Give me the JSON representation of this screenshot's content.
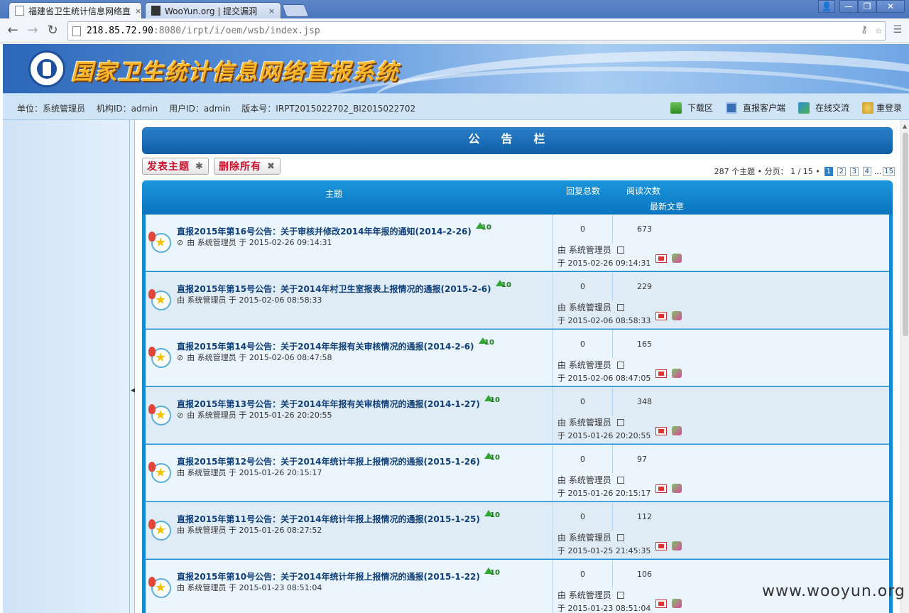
{
  "browser": {
    "tabs": [
      {
        "label": "福建省卫生统计信息网络直",
        "close": "×"
      },
      {
        "label": "WooYun.org | 提交漏洞",
        "close": "×"
      }
    ],
    "url_host": "218.85.72.90",
    "url_rest": ":8080/irpt/i/oem/wsb/index.jsp",
    "window_buttons": [
      "👤",
      "—",
      "❐",
      "✕"
    ]
  },
  "header": {
    "system_title": "国家卫生统计信息网络直报系统"
  },
  "infobar": {
    "unit": "单位：系统管理员",
    "org_id": "机构ID：admin",
    "user_id": "用户ID：admin",
    "version": "版本号：IRPT2015022702_BI2015022702",
    "links": [
      "下载区",
      "直报客户端",
      "在线交流",
      "重登录"
    ]
  },
  "bulletin": {
    "title": "公告栏",
    "post_button": "发表主题",
    "delete_button": "删除所有",
    "pager": {
      "summary": "287 个主题 • 分页： 1 / 15 •",
      "pages": [
        "1",
        "2",
        "3",
        "4"
      ],
      "ellipsis": "...",
      "last": "15"
    },
    "columns": {
      "topic": "主题",
      "replies": "回复总数",
      "views": "阅读次数",
      "latest": "最新文章"
    },
    "rows": [
      {
        "title": "直报2015年第16号公告：关于审核并修改2014年年报的通知(2014-2-26)",
        "attach": true,
        "meta": "由 系统管理员 于 2015-02-26 09:14:31",
        "replies": "0",
        "views": "673",
        "latest_by": "由 系统管理员",
        "latest_at": "于 2015-02-26 09:14:31"
      },
      {
        "title": "直报2015年第15号公告：关于2014年村卫生室报表上报情况的通报(2015-2-6)",
        "attach": false,
        "meta": "由 系统管理员 于 2015-02-06 08:58:33",
        "replies": "0",
        "views": "229",
        "latest_by": "由 系统管理员",
        "latest_at": "于 2015-02-06 08:58:33"
      },
      {
        "title": "直报2015年第14号公告：关于2014年年报有关审核情况的通报(2014-2-6)",
        "attach": true,
        "meta": "由 系统管理员 于 2015-02-06 08:47:58",
        "replies": "0",
        "views": "165",
        "latest_by": "由 系统管理员",
        "latest_at": "于 2015-02-06 08:47:05"
      },
      {
        "title": "直报2015年第13号公告：关于2014年年报有关审核情况的通报(2014-1-27)",
        "attach": true,
        "meta": "由 系统管理员 于 2015-01-26 20:20:55",
        "replies": "0",
        "views": "348",
        "latest_by": "由 系统管理员",
        "latest_at": "于 2015-01-26 20:20:55"
      },
      {
        "title": "直报2015年第12号公告：关于2014年统计年报上报情况的通报(2015-1-26)",
        "attach": false,
        "meta": "由 系统管理员 于 2015-01-26 20:15:17",
        "replies": "0",
        "views": "97",
        "latest_by": "由 系统管理员",
        "latest_at": "于 2015-01-26 20:15:17"
      },
      {
        "title": "直报2015年第11号公告：关于2014年统计年报上报情况的通报(2015-1-25)",
        "attach": false,
        "meta": "由 系统管理员 于 2015-01-26 08:27:52",
        "replies": "0",
        "views": "112",
        "latest_by": "由 系统管理员",
        "latest_at": "于 2015-01-25 21:45:35"
      },
      {
        "title": "直报2015年第10号公告：关于2014年统计年报上报情况的通报(2015-1-22)",
        "attach": false,
        "meta": "由 系统管理员 于 2015-01-23 08:51:04",
        "replies": "0",
        "views": "106",
        "latest_by": "由 系统管理员",
        "latest_at": "于 2015-01-23 08:51:04"
      }
    ],
    "top_badge": "10"
  },
  "watermark": "www.wooyun.org",
  "colors": {
    "accent": "#128bd3",
    "title_text": "#0e3f7a",
    "button_text": "#c8102e",
    "banner_title": "#f7b52a"
  }
}
